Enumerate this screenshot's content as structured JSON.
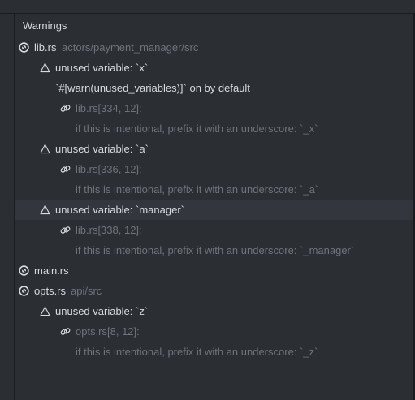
{
  "panel": {
    "title": "Warnings"
  },
  "files": [
    {
      "name": "lib.rs",
      "path": "actors/payment_manager/src",
      "icon": "rust-icon",
      "warnings": [
        {
          "message": "unused variable: `x`",
          "note": "`#[warn(unused_variables)]` on by default",
          "location": "lib.rs[334, 12]:",
          "help": "if this is intentional, prefix it with an underscore: `_x`"
        },
        {
          "message": "unused variable: `a`",
          "location": "lib.rs[336, 12]:",
          "help": "if this is intentional, prefix it with an underscore: `_a`"
        },
        {
          "message": "unused variable: `manager`",
          "location": "lib.rs[338, 12]:",
          "help": "if this is intentional, prefix it with an underscore: `_manager`"
        }
      ]
    },
    {
      "name": "main.rs",
      "icon": "rust-icon",
      "warnings": []
    },
    {
      "name": "opts.rs",
      "path": "api/src",
      "icon": "rust-icon",
      "warnings": [
        {
          "message": "unused variable: `z`",
          "location": "opts.rs[8, 12]:",
          "help": "if this is intentional, prefix it with an underscore: `_z`"
        }
      ]
    }
  ],
  "colors": {
    "background": "#2b2e33",
    "text": "#d7dadf",
    "muted": "#6f747b",
    "hover_row": "#33373d",
    "borders": "#1a1c1f"
  }
}
